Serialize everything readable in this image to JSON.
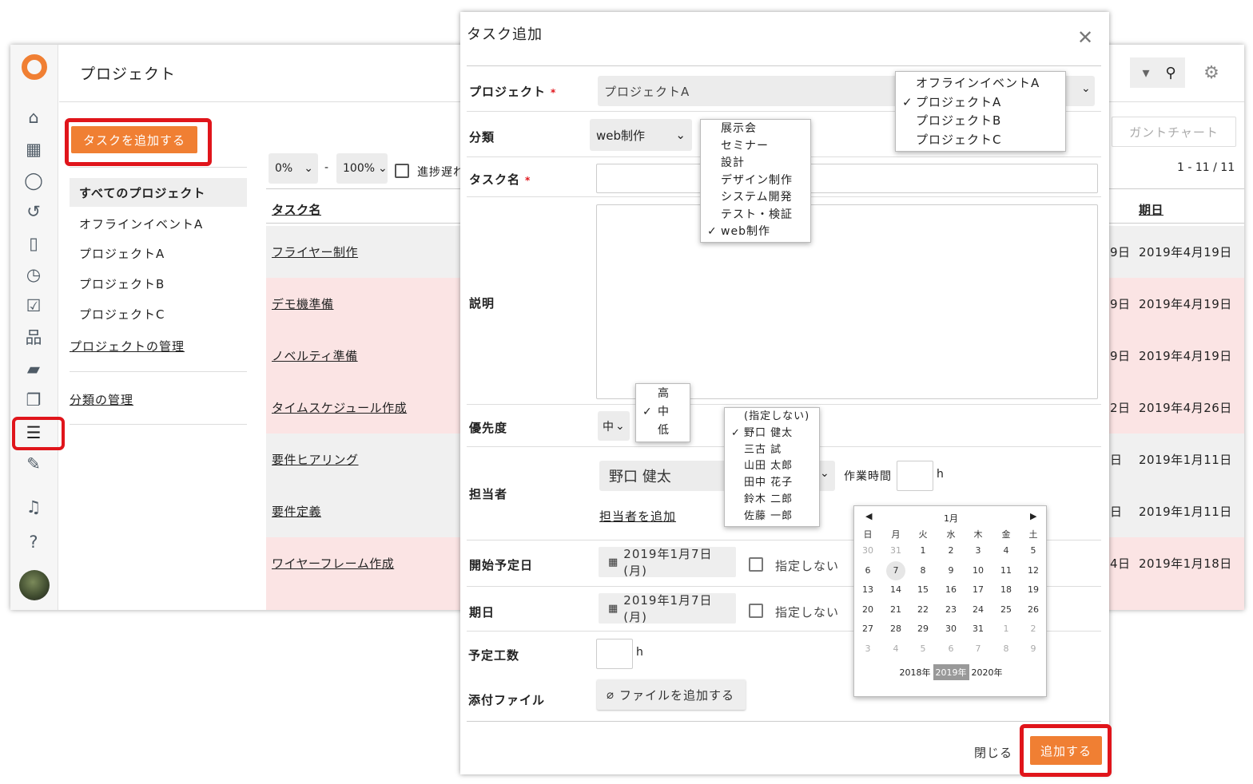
{
  "app": {
    "page_title": "プロジェクト",
    "add_task_label": "タスクを追加する",
    "gantt_label": "ガントチャート",
    "pagination": "1 - 11 / 11",
    "nav": {
      "all": "すべてのプロジェクト",
      "items": [
        "オフラインイベントA",
        "プロジェクトA",
        "プロジェクトB",
        "プロジェクトC"
      ],
      "manage_projects": "プロジェクトの管理",
      "manage_categories": "分類の管理"
    },
    "filters": {
      "from": "0%",
      "sep": "-",
      "to": "100%",
      "delay_label": "進捗遅れ"
    },
    "table": {
      "col_task": "タスク名",
      "col_due": "期日",
      "rows": [
        {
          "name": "フライヤー制作",
          "start": "9日",
          "due": "2019年4月19日"
        },
        {
          "name": "デモ機準備",
          "start": "9日",
          "due": "2019年4月19日"
        },
        {
          "name": "ノベルティ準備",
          "start": "9日",
          "due": "2019年4月19日"
        },
        {
          "name": "タイムスケジュール作成",
          "start": "2日",
          "due": "2019年4月26日"
        },
        {
          "name": "要件ヒアリング",
          "start": "日",
          "due": "2019年1月11日"
        },
        {
          "name": "要件定義",
          "start": "日",
          "due": "2019年1月11日"
        },
        {
          "name": "ワイヤーフレーム作成",
          "start": "4日",
          "due": "2019年1月18日"
        }
      ]
    }
  },
  "colors": {
    "accent": "#f07f33",
    "highlight": "#e0151b",
    "row_pink": "#fbe4e4",
    "row_gray": "#f0f0f0"
  },
  "icons": [
    "home-icon",
    "calendar-icon",
    "chat-icon",
    "history-icon",
    "clipboard-icon",
    "clock-icon",
    "checkbox-icon",
    "org-chart-icon",
    "folder-icon",
    "copy-icon",
    "task-list-icon",
    "edit-icon",
    "bell-icon",
    "help-icon",
    "search-icon",
    "gear-icon",
    "close-icon",
    "paperclip-icon"
  ],
  "dialog": {
    "title": "タスク追加",
    "project_label": "プロジェクト",
    "project_value": "プロジェクトA",
    "project_options": [
      "オフラインイベントA",
      "プロジェクトA",
      "プロジェクトB",
      "プロジェクトC"
    ],
    "category_label": "分類",
    "category_value": "web制作",
    "category_options": [
      "展示会",
      "セミナー",
      "設計",
      "デザイン制作",
      "システム開発",
      "テスト・検証",
      "web制作"
    ],
    "taskname_label": "タスク名",
    "description_label": "説明",
    "priority_label": "優先度",
    "priority_value": "中",
    "priority_options": [
      "高",
      "中",
      "低"
    ],
    "assignee_label": "担当者",
    "assignee_value": "野口 健太",
    "assignee_options": [
      "(指定しない)",
      "野口 健太",
      "三古 試",
      "山田 太郎",
      "田中 花子",
      "鈴木 二郎",
      "佐藤 一郎"
    ],
    "add_assignee": "担当者を追加",
    "work_time_label": "作業時間",
    "hour_unit": "h",
    "start_label": "開始予定日",
    "start_value": "2019年1月7日(月)",
    "due_label": "期日",
    "due_value": "2019年1月7日(月)",
    "unspecified": "指定しない",
    "effort_label": "予定工数",
    "attach_label": "添付ファイル",
    "attach_button": "ファイルを追加する",
    "close_label": "閉じる",
    "submit_label": "追加する",
    "required_mark": "*"
  },
  "calendar": {
    "month": "1月",
    "weekdays": [
      "日",
      "月",
      "火",
      "水",
      "木",
      "金",
      "土"
    ],
    "weeks": [
      [
        "30",
        "31",
        "1",
        "2",
        "3",
        "4",
        "5"
      ],
      [
        "6",
        "7",
        "8",
        "9",
        "10",
        "11",
        "12"
      ],
      [
        "13",
        "14",
        "15",
        "16",
        "17",
        "18",
        "19"
      ],
      [
        "20",
        "21",
        "22",
        "23",
        "24",
        "25",
        "26"
      ],
      [
        "27",
        "28",
        "29",
        "30",
        "31",
        "1",
        "2"
      ],
      [
        "3",
        "4",
        "5",
        "6",
        "7",
        "8",
        "9"
      ]
    ],
    "years": [
      "2018年",
      "2019年",
      "2020年"
    ],
    "selected_day": "7",
    "selected_year": "2019年"
  }
}
